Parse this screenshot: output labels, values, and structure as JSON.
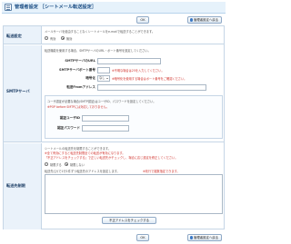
{
  "header": {
    "title": "管理者設定 ［シートメール転送設定］"
  },
  "toolbar": {
    "ok_label": "OK",
    "back_label": "管理者設定へ戻る"
  },
  "rows": {
    "transfer": {
      "label": "転送設定",
      "description": "メールサーバを経由することなくシートメールをe-mailで転送することができます。",
      "on_label": "有効",
      "off_label": "無効",
      "selected": "off"
    },
    "smtp": {
      "label": "SMTPサーバ",
      "description": "転送機能を使用する場合、SMTPサーバのURL・ポート番号を設定してください。",
      "url_label": "SMTPサーバのURL",
      "url_value": "",
      "port_label": "SMTPサーバポート番号",
      "port_value": "",
      "port_hint": "※不明な場合は25を入力してください。",
      "encrypt_label": "暗号化",
      "encrypt_value": "なし",
      "encrypt_hint": "※暗号化を使用する場合はポート番号をご確認ください。",
      "from_label": "転送Fromアドレス",
      "from_value": "",
      "auth_note": "ユーザ認証が必要な場合(SMTP認証)はユーザID、パスワードを設定してください。",
      "auth_note2": "※POP before SMTPには対応しておりません。",
      "userid_label": "認証ユーザID",
      "userid_value": "",
      "password_label": "認証パスワード",
      "password_value": ""
    },
    "target": {
      "label": "転送先制限",
      "description": "シートメールの転送先を制限することができます。",
      "desc2": "※全て有効にすると転送先制限全ての転送が有効になります。",
      "desc3": "「不正アドレスをチェックする」で正しい転送先かチェックし、場合に応じ設定を修正してください。",
      "enable_label": "制限する",
      "disable_label": "制限しない",
      "selected": "disable",
      "note": "転送先(ひ)で1行1件ずつ転送先のアドレスを設定します。",
      "note_hint": "※改行で複数指定できます。",
      "textarea_value": "",
      "check_button": "不正アドレスをチェックする"
    }
  },
  "colors": {
    "accent": "#1e5086",
    "header_bg": "#e6f2fb",
    "row_head_bg": "#eaf2fa",
    "warning": "#d0302a"
  }
}
